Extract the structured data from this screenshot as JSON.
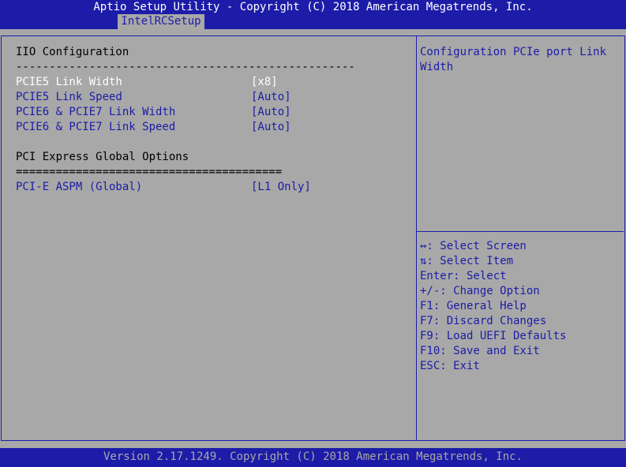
{
  "header": {
    "title": "Aptio Setup Utility - Copyright (C) 2018 American Megatrends, Inc.",
    "tab": "IntelRCSetup"
  },
  "main": {
    "section_title": "IIO Configuration",
    "separator_1": "---------------------------------------------------",
    "items": [
      {
        "label": "PCIE5 Link Width",
        "value": "[x8]"
      },
      {
        "label": "PCIE5 Link Speed",
        "value": "[Auto]"
      },
      {
        "label": "PCIE6 & PCIE7 Link Width",
        "value": "[Auto]"
      },
      {
        "label": "PCIE6 & PCIE7 Link Speed",
        "value": "[Auto]"
      }
    ],
    "global_title": "PCI Express Global Options",
    "separator_2": "========================================",
    "global_items": [
      {
        "label": "PCI-E ASPM (Global)",
        "value": "[L1 Only]"
      }
    ]
  },
  "help": {
    "description": "Configuration PCIe port Link Width",
    "keys": [
      "↔: Select Screen",
      "⇅: Select Item",
      "Enter: Select",
      "+/-: Change Option",
      "F1: General Help",
      "F7: Discard Changes",
      "F9: Load UEFI Defaults",
      "F10: Save and Exit",
      "ESC: Exit"
    ]
  },
  "footer": {
    "text": "Version 2.17.1249. Copyright (C) 2018 American Megatrends, Inc."
  },
  "colors": {
    "background": "#a8a8a8",
    "blue": "#1c1ca8",
    "highlight": "#ffffff",
    "text": "#000000"
  }
}
